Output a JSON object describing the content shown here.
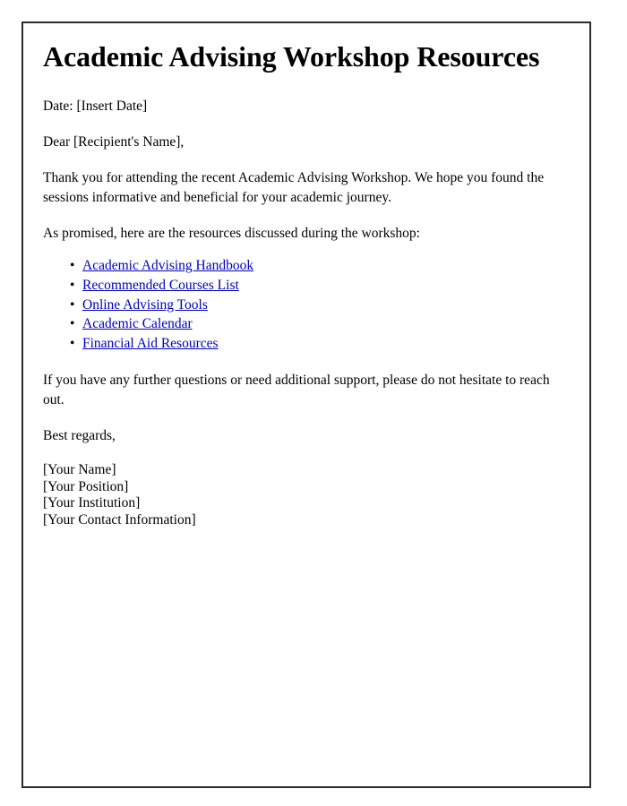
{
  "document": {
    "title": "Academic Advising Workshop Resources",
    "date_line": "Date: [Insert Date]",
    "salutation": "Dear [Recipient's Name],",
    "paragraph_1": "Thank you for attending the recent Academic Advising Workshop. We hope you found the sessions informative and beneficial for your academic journey.",
    "paragraph_2": "As promised, here are the resources discussed during the workshop:",
    "resources": [
      {
        "label": "Academic Advising Handbook",
        "bullet": "•"
      },
      {
        "label": "Recommended Courses List",
        "bullet": "•"
      },
      {
        "label": "Online Advising Tools",
        "bullet": "•"
      },
      {
        "label": "Academic Calendar",
        "bullet": "•"
      },
      {
        "label": "Financial Aid Resources",
        "bullet": "•"
      }
    ],
    "paragraph_3": "If you have any further questions or need additional support, please do not hesitate to reach out.",
    "closing": "Best regards,",
    "signature": [
      "[Your Name]",
      "[Your Position]",
      "[Your Institution]",
      "[Your Contact Information]"
    ],
    "colors": {
      "link": "#0000bb",
      "text": "#000000",
      "border": "#2b2b2b",
      "background": "#ffffff"
    }
  }
}
